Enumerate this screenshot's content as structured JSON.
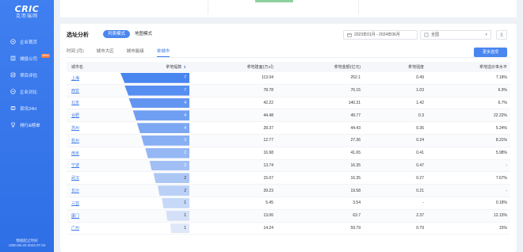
{
  "sidebar": {
    "logo_main": "CRIC",
    "logo_sub": "克而瑞网",
    "items": [
      {
        "label": "企业首页",
        "icon": "home-icon"
      },
      {
        "label": "城投公司",
        "icon": "building-icon",
        "badge": "NEW"
      },
      {
        "label": "项目评估",
        "icon": "chart-icon"
      },
      {
        "label": "企业对比",
        "icon": "compare-icon"
      },
      {
        "label": "资讯24H",
        "icon": "news-icon"
      },
      {
        "label": "排行&榜单",
        "icon": "trophy-icon"
      }
    ],
    "footer_line1": "数据起止时间",
    "footer_line2": "1900.06.20-2024.07.04"
  },
  "panel": {
    "title": "选址分析",
    "modes": [
      "列表模式",
      "地图模式"
    ],
    "active_mode": 0,
    "date_range": "2023年01月 - 2024年06月",
    "city_select": "全国",
    "tabs": [
      "时间 (月)",
      "城市大区",
      "城市能级",
      "单城市"
    ],
    "active_tab": 3,
    "custom_button": "更多选项"
  },
  "table": {
    "headers": {
      "city": "城市名",
      "count": "拿地幅数",
      "area": "拿地建面(万㎡)",
      "amount": "拿地金额(亿元)",
      "intensity": "拿地强度",
      "premium": "拿地溢价率水平"
    },
    "rows": [
      {
        "city": "上海",
        "count": 7,
        "area": "113.04",
        "amount": "252.1",
        "intensity": "0.49",
        "premium": "7.18%"
      },
      {
        "city": "西安",
        "count": 7,
        "area": "78.78",
        "amount": "76.15",
        "intensity": "1.03",
        "premium": "6.9%"
      },
      {
        "city": "北京",
        "count": 4,
        "area": "42.22",
        "amount": "140.31",
        "intensity": "1.42",
        "premium": "6.7%"
      },
      {
        "city": "合肥",
        "count": 4,
        "area": "44.48",
        "amount": "49.77",
        "intensity": "0.3",
        "premium": "22.22%"
      },
      {
        "city": "苏州",
        "count": 4,
        "area": "28.37",
        "amount": "44.43",
        "intensity": "0.36",
        "premium": "5.24%"
      },
      {
        "city": "杭州",
        "count": 3,
        "area": "12.77",
        "amount": "27.36",
        "intensity": "0.24",
        "premium": "8.31%"
      },
      {
        "city": "南京",
        "count": 2,
        "area": "16.98",
        "amount": "41.65",
        "intensity": "0.41",
        "premium": "5.98%"
      },
      {
        "city": "宁波",
        "count": 2,
        "area": "13.74",
        "amount": "16.35",
        "intensity": "0.47",
        "premium": "-"
      },
      {
        "city": "武汉",
        "count": 2,
        "area": "15.07",
        "amount": "16.35",
        "intensity": "0.27",
        "premium": "7.67%"
      },
      {
        "city": "长沙",
        "count": 2,
        "area": "39.23",
        "amount": "19.58",
        "intensity": "0.21",
        "premium": "-"
      },
      {
        "city": "三亚",
        "count": 1,
        "area": "5.45",
        "amount": "3.54",
        "intensity": "-",
        "premium": "0.18%"
      },
      {
        "city": "厦门",
        "count": 1,
        "area": "13.06",
        "amount": "63.7",
        "intensity": "2.37",
        "premium": "12.15%"
      },
      {
        "city": "广州",
        "count": 1,
        "area": "14.24",
        "amount": "59.79",
        "intensity": "0.79",
        "premium": "15%"
      }
    ],
    "bar_color_dark": "#4a86f0",
    "bar_color_light": "#dfe8f8"
  }
}
